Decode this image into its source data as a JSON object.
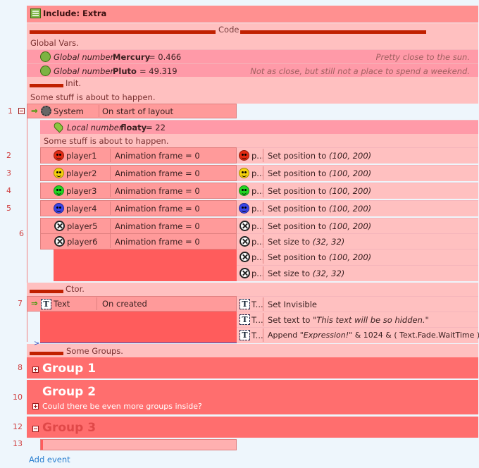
{
  "include": {
    "title": "Include: Extra"
  },
  "code_header": "Code",
  "global_vars_comment": "Global Vars.",
  "globals": [
    {
      "kind": "Global number",
      "name": "Mercury",
      "value": "= 0.466",
      "comment": "Pretty close to the sun."
    },
    {
      "kind": "Global number",
      "name": "Pluto",
      "value": "= 49.319",
      "comment": "Not as close, but still not a place to spend a weekend."
    }
  ],
  "init_header": "Init.",
  "stuff_comment": "Some stuff is about to happen.",
  "event1": {
    "number": "1",
    "object": "System",
    "condition": "On start of layout",
    "local": {
      "kind": "Local number",
      "name": "floaty",
      "value": "= 22"
    },
    "comment": "Some stuff is about to happen."
  },
  "sub_events": [
    {
      "number": "2",
      "object": "player1",
      "condition": "Animation frame = 0",
      "icon_color": "#e42a12",
      "action_obj": "p...",
      "action": "Set position to ",
      "params": "(100, 200)"
    },
    {
      "number": "3",
      "object": "player2",
      "condition": "Animation frame = 0",
      "icon_color": "#f6d10c",
      "action_obj": "p...",
      "action": "Set position to ",
      "params": "(100, 200)"
    },
    {
      "number": "4",
      "object": "player3",
      "condition": "Animation frame = 0",
      "icon_color": "#22d422",
      "action_obj": "p...",
      "action": "Set position to ",
      "params": "(100, 200)"
    },
    {
      "number": "5",
      "object": "player4",
      "condition": "Animation frame = 0",
      "icon_color": "#3a44e8",
      "action_obj": "p...",
      "action": "Set position to ",
      "params": "(100, 200)"
    }
  ],
  "event6": {
    "number": "6",
    "conditions": [
      {
        "object": "player5",
        "condition": "Animation frame = 0"
      },
      {
        "object": "player6",
        "condition": "Animation frame = 0"
      }
    ],
    "actions": [
      {
        "obj": "p...",
        "action": "Set position to ",
        "params": "(100, 200)"
      },
      {
        "obj": "p...",
        "action": "Set size to ",
        "params": "(32, 32)"
      },
      {
        "obj": "p...",
        "action": "Set position to ",
        "params": "(100, 200)"
      },
      {
        "obj": "p...",
        "action": "Set size to ",
        "params": "(32, 32)"
      }
    ]
  },
  "ctor_header": "Ctor.",
  "event7": {
    "number": "7",
    "object": "Text",
    "condition": "On created",
    "actions": [
      {
        "obj": "T...",
        "action": "Set Invisible",
        "params": ""
      },
      {
        "obj": "T...",
        "action": "Set text to ",
        "params": "\"This text will be so hidden.\""
      },
      {
        "obj": "T...",
        "action": "Append ",
        "params": "\"Expression!\"",
        "rest": " & 1024 & ( Text.Fade.WaitTime )"
      }
    ]
  },
  "groups_header": "Some Groups.",
  "groups": [
    {
      "number": "8",
      "title": "Group 1",
      "description": ""
    },
    {
      "number": "10",
      "title": "Group 2",
      "description": "Could there be even more groups inside?"
    },
    {
      "number": "12",
      "title": "Group 3",
      "description": ""
    }
  ],
  "event13": {
    "number": "13"
  },
  "add_event": "Add event",
  "colors": {
    "accent_red": "#c02000",
    "group": "#ff6e6e",
    "row": "#ffc0c0",
    "variable": "#ff9aa8",
    "link": "#2a7fd0"
  }
}
